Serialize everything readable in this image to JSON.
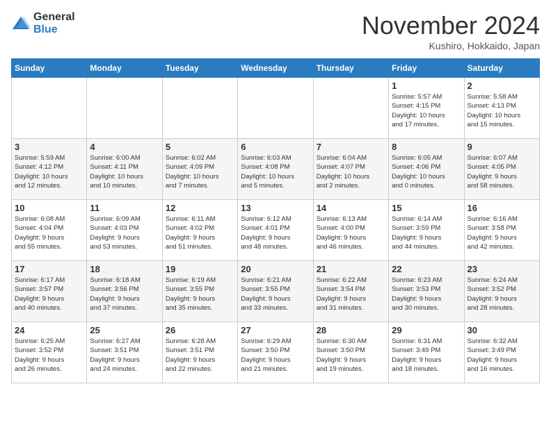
{
  "header": {
    "logo_general": "General",
    "logo_blue": "Blue",
    "month_title": "November 2024",
    "location": "Kushiro, Hokkaido, Japan"
  },
  "weekdays": [
    "Sunday",
    "Monday",
    "Tuesday",
    "Wednesday",
    "Thursday",
    "Friday",
    "Saturday"
  ],
  "weeks": [
    [
      {
        "day": "",
        "info": ""
      },
      {
        "day": "",
        "info": ""
      },
      {
        "day": "",
        "info": ""
      },
      {
        "day": "",
        "info": ""
      },
      {
        "day": "",
        "info": ""
      },
      {
        "day": "1",
        "info": "Sunrise: 5:57 AM\nSunset: 4:15 PM\nDaylight: 10 hours\nand 17 minutes."
      },
      {
        "day": "2",
        "info": "Sunrise: 5:58 AM\nSunset: 4:13 PM\nDaylight: 10 hours\nand 15 minutes."
      }
    ],
    [
      {
        "day": "3",
        "info": "Sunrise: 5:59 AM\nSunset: 4:12 PM\nDaylight: 10 hours\nand 12 minutes."
      },
      {
        "day": "4",
        "info": "Sunrise: 6:00 AM\nSunset: 4:11 PM\nDaylight: 10 hours\nand 10 minutes."
      },
      {
        "day": "5",
        "info": "Sunrise: 6:02 AM\nSunset: 4:09 PM\nDaylight: 10 hours\nand 7 minutes."
      },
      {
        "day": "6",
        "info": "Sunrise: 6:03 AM\nSunset: 4:08 PM\nDaylight: 10 hours\nand 5 minutes."
      },
      {
        "day": "7",
        "info": "Sunrise: 6:04 AM\nSunset: 4:07 PM\nDaylight: 10 hours\nand 2 minutes."
      },
      {
        "day": "8",
        "info": "Sunrise: 6:05 AM\nSunset: 4:06 PM\nDaylight: 10 hours\nand 0 minutes."
      },
      {
        "day": "9",
        "info": "Sunrise: 6:07 AM\nSunset: 4:05 PM\nDaylight: 9 hours\nand 58 minutes."
      }
    ],
    [
      {
        "day": "10",
        "info": "Sunrise: 6:08 AM\nSunset: 4:04 PM\nDaylight: 9 hours\nand 55 minutes."
      },
      {
        "day": "11",
        "info": "Sunrise: 6:09 AM\nSunset: 4:03 PM\nDaylight: 9 hours\nand 53 minutes."
      },
      {
        "day": "12",
        "info": "Sunrise: 6:11 AM\nSunset: 4:02 PM\nDaylight: 9 hours\nand 51 minutes."
      },
      {
        "day": "13",
        "info": "Sunrise: 6:12 AM\nSunset: 4:01 PM\nDaylight: 9 hours\nand 48 minutes."
      },
      {
        "day": "14",
        "info": "Sunrise: 6:13 AM\nSunset: 4:00 PM\nDaylight: 9 hours\nand 46 minutes."
      },
      {
        "day": "15",
        "info": "Sunrise: 6:14 AM\nSunset: 3:59 PM\nDaylight: 9 hours\nand 44 minutes."
      },
      {
        "day": "16",
        "info": "Sunrise: 6:16 AM\nSunset: 3:58 PM\nDaylight: 9 hours\nand 42 minutes."
      }
    ],
    [
      {
        "day": "17",
        "info": "Sunrise: 6:17 AM\nSunset: 3:57 PM\nDaylight: 9 hours\nand 40 minutes."
      },
      {
        "day": "18",
        "info": "Sunrise: 6:18 AM\nSunset: 3:56 PM\nDaylight: 9 hours\nand 37 minutes."
      },
      {
        "day": "19",
        "info": "Sunrise: 6:19 AM\nSunset: 3:55 PM\nDaylight: 9 hours\nand 35 minutes."
      },
      {
        "day": "20",
        "info": "Sunrise: 6:21 AM\nSunset: 3:55 PM\nDaylight: 9 hours\nand 33 minutes."
      },
      {
        "day": "21",
        "info": "Sunrise: 6:22 AM\nSunset: 3:54 PM\nDaylight: 9 hours\nand 31 minutes."
      },
      {
        "day": "22",
        "info": "Sunrise: 6:23 AM\nSunset: 3:53 PM\nDaylight: 9 hours\nand 30 minutes."
      },
      {
        "day": "23",
        "info": "Sunrise: 6:24 AM\nSunset: 3:52 PM\nDaylight: 9 hours\nand 28 minutes."
      }
    ],
    [
      {
        "day": "24",
        "info": "Sunrise: 6:25 AM\nSunset: 3:52 PM\nDaylight: 9 hours\nand 26 minutes."
      },
      {
        "day": "25",
        "info": "Sunrise: 6:27 AM\nSunset: 3:51 PM\nDaylight: 9 hours\nand 24 minutes."
      },
      {
        "day": "26",
        "info": "Sunrise: 6:28 AM\nSunset: 3:51 PM\nDaylight: 9 hours\nand 22 minutes."
      },
      {
        "day": "27",
        "info": "Sunrise: 6:29 AM\nSunset: 3:50 PM\nDaylight: 9 hours\nand 21 minutes."
      },
      {
        "day": "28",
        "info": "Sunrise: 6:30 AM\nSunset: 3:50 PM\nDaylight: 9 hours\nand 19 minutes."
      },
      {
        "day": "29",
        "info": "Sunrise: 6:31 AM\nSunset: 3:49 PM\nDaylight: 9 hours\nand 18 minutes."
      },
      {
        "day": "30",
        "info": "Sunrise: 6:32 AM\nSunset: 3:49 PM\nDaylight: 9 hours\nand 16 minutes."
      }
    ]
  ]
}
